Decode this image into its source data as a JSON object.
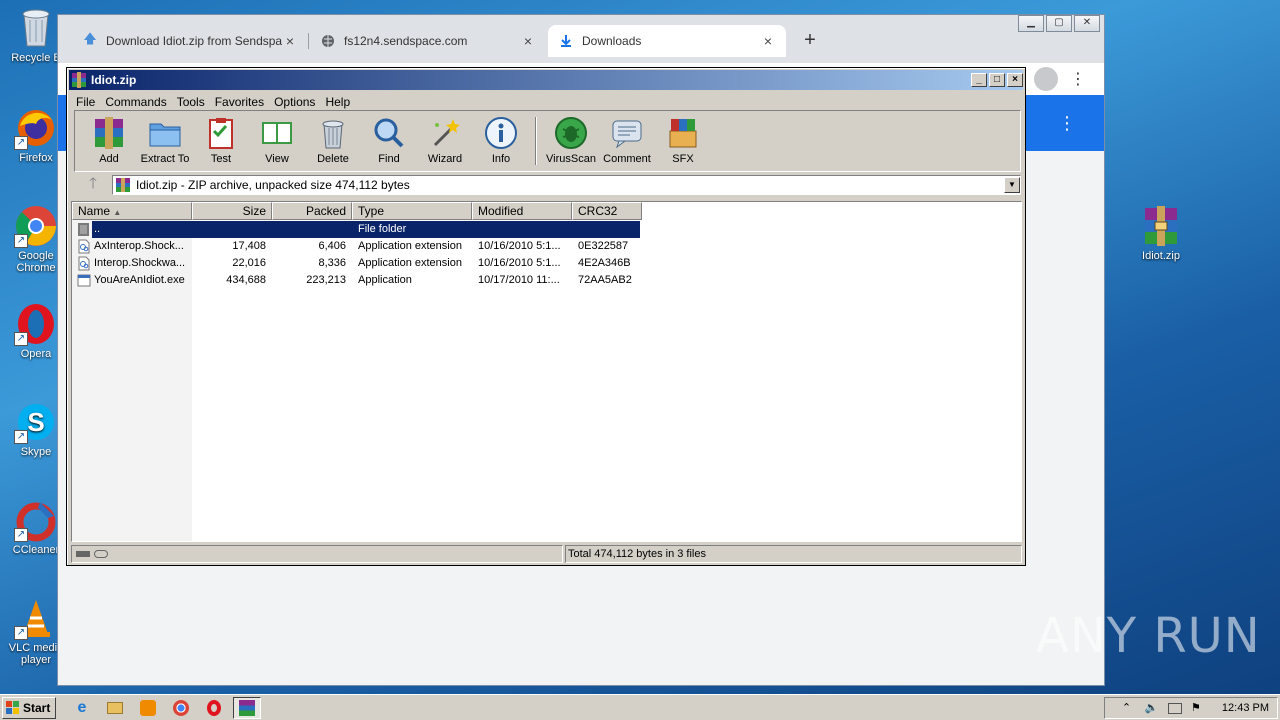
{
  "desktop": {
    "icons": [
      {
        "label": "Recycle B",
        "icon": "recycle-bin-icon"
      },
      {
        "label": "Firefox",
        "icon": "firefox-icon"
      },
      {
        "label": "Google Chrome",
        "icon": "chrome-icon"
      },
      {
        "label": "Opera",
        "icon": "opera-icon"
      },
      {
        "label": "Skype",
        "icon": "skype-icon"
      },
      {
        "label": "CCleaner",
        "icon": "ccleaner-icon"
      },
      {
        "label": "VLC media player",
        "icon": "vlc-icon"
      }
    ],
    "right_icon": {
      "label": "Idiot.zip",
      "icon": "winrar-archive-icon"
    }
  },
  "browser": {
    "tabs": [
      {
        "title": "Download Idiot.zip from Sendspace.c",
        "icon": "upload-arrow-icon"
      },
      {
        "title": "fs12n4.sendspace.com",
        "icon": "globe-icon"
      },
      {
        "title": "Downloads",
        "icon": "download-icon",
        "active": true
      }
    ],
    "new_tab": "+",
    "close_glyph": "×",
    "header_color": "#1a73e8"
  },
  "winrar": {
    "title": "Idiot.zip",
    "menu": [
      "File",
      "Commands",
      "Tools",
      "Favorites",
      "Options",
      "Help"
    ],
    "toolbar": [
      "Add",
      "Extract To",
      "Test",
      "View",
      "Delete",
      "Find",
      "Wizard",
      "Info",
      "VirusScan",
      "Comment",
      "SFX"
    ],
    "address": "Idiot.zip - ZIP archive, unpacked size 474,112 bytes",
    "columns": [
      "Name",
      "Size",
      "Packed",
      "Type",
      "Modified",
      "CRC32"
    ],
    "rows": [
      {
        "name": "..",
        "size": "",
        "packed": "",
        "type": "File folder",
        "modified": "",
        "crc": "",
        "selected": true
      },
      {
        "name": "AxInterop.Shock...",
        "size": "17,408",
        "packed": "6,406",
        "type": "Application extension",
        "modified": "10/16/2010 5:1...",
        "crc": "0E322587"
      },
      {
        "name": "Interop.Shockwa...",
        "size": "22,016",
        "packed": "8,336",
        "type": "Application extension",
        "modified": "10/16/2010 5:1...",
        "crc": "4E2A346B"
      },
      {
        "name": "YouAreAnIdiot.exe",
        "size": "434,688",
        "packed": "223,213",
        "type": "Application",
        "modified": "10/17/2010 11:...",
        "crc": "72AA5AB2"
      }
    ],
    "status": "Total 474,112 bytes in 3 files"
  },
  "taskbar": {
    "start": "Start",
    "clock": "12:43 PM"
  },
  "watermark": "ANY RUN"
}
